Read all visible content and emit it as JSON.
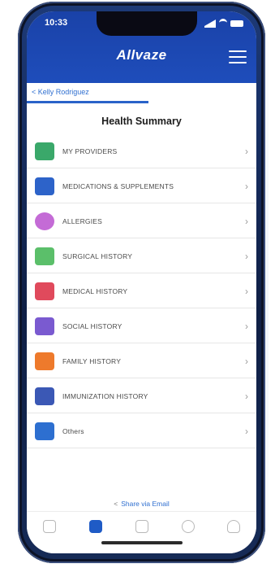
{
  "status_bar": {
    "time": "10:33"
  },
  "header": {
    "logo": "Allvaze",
    "menu_icon": "hamburger-menu-icon"
  },
  "breadcrumb": {
    "label": "< Kelly Rodriguez"
  },
  "page": {
    "title": "Health Summary"
  },
  "items": [
    {
      "label": "MY PROVIDERS",
      "icon": "providers-icon",
      "color": "#3aa86a"
    },
    {
      "label": "MEDICATIONS & SUPPLEMENTS",
      "icon": "medications-icon",
      "color": "#2d63c9"
    },
    {
      "label": "ALLERGIES",
      "icon": "allergies-icon",
      "color": "#c46bd6"
    },
    {
      "label": "SURGICAL HISTORY",
      "icon": "surgical-icon",
      "color": "#5bbf6a"
    },
    {
      "label": "MEDICAL HISTORY",
      "icon": "medical-icon",
      "color": "#e04a5c"
    },
    {
      "label": "SOCIAL HISTORY",
      "icon": "social-icon",
      "color": "#7a5ad0"
    },
    {
      "label": "FAMILY HISTORY",
      "icon": "family-icon",
      "color": "#ee7a2c"
    },
    {
      "label": "IMMUNIZATION HISTORY",
      "icon": "immunization-icon",
      "color": "#3b58b5"
    },
    {
      "label": "Others",
      "icon": "others-icon",
      "color": "#2d6fd0"
    }
  ],
  "share": {
    "label": "Share via Email",
    "icon": "share-icon"
  },
  "tabs": [
    {
      "icon": "phone-icon",
      "label": "",
      "active": false
    },
    {
      "icon": "health-icon",
      "label": "",
      "active": true
    },
    {
      "icon": "documents-icon",
      "label": "",
      "active": false
    },
    {
      "icon": "settings-icon",
      "label": "",
      "active": false
    },
    {
      "icon": "profile-icon",
      "label": "",
      "active": false
    }
  ],
  "colors": {
    "accent": "#1f4fbe",
    "link": "#2f6fd0"
  }
}
